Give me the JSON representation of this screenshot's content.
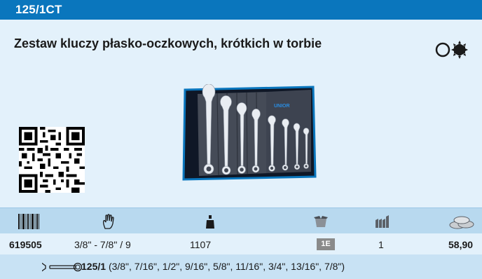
{
  "header": {
    "code": "125/1CT",
    "bar_color": "#0a76bd"
  },
  "product": {
    "title": "Zestaw kluczy płasko-oczkowych, krótkich w torbie",
    "image_brand": "UNIOR",
    "fit_icons": [
      "ring-icon",
      "hex-gear-icon"
    ]
  },
  "table": {
    "header_icons": [
      "barcode-icon",
      "hand-icon",
      "weight-icon",
      "box-icon",
      "pack-icon",
      "coins-icon"
    ],
    "row": {
      "article": "619505",
      "range": "3/8\" - 7/8\" / 9",
      "weight": "1107",
      "badge": "1E",
      "quantity": "1",
      "price": "58,90"
    },
    "sub": {
      "code": "125/1",
      "sizes": "(3/8\", 7/16\", 1/2\", 9/16\", 5/8\", 11/16\", 3/4\", 13/16\", 7/8\")"
    }
  },
  "colors": {
    "panel": "#e3f1fb",
    "header_row": "#b8d9ef",
    "sub_row": "#c8e2f4"
  }
}
